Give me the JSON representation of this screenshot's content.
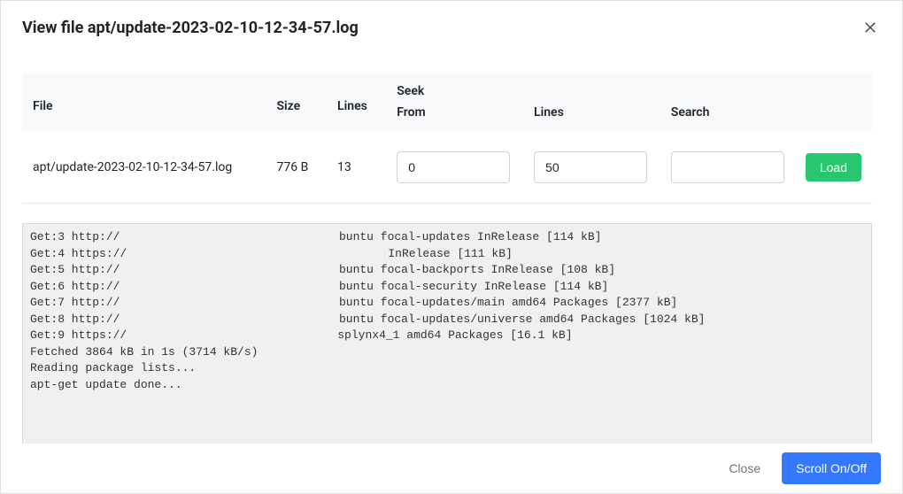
{
  "header": {
    "title": "View file apt/update-2023-02-10-12-34-57.log"
  },
  "table": {
    "columns": {
      "file": "File",
      "size": "Size",
      "lines": "Lines",
      "seek": "Seek"
    },
    "seek_columns": {
      "from": "From",
      "lines": "Lines",
      "search": "Search"
    },
    "row": {
      "file": "apt/update-2023-02-10-12-34-57.log",
      "size": "776 B",
      "lines": "13"
    },
    "inputs": {
      "from_value": "0",
      "lines_value": "50",
      "search_value": ""
    },
    "load_label": "Load"
  },
  "log_lines": [
    "Get:3 http://⠀⠀⠀⠀⠀⠀⠀⠀⠀⠀⠀⠀⠀⠀⠀⠀⠀⠀⠀⠀⠀⠀⠀⠀⠀⠀buntu focal-updates InRelease [114 kB]",
    "Get:4 https://⠀⠀⠀⠀⠀⠀⠀⠀⠀⠀⠀⠀⠀⠀⠀⠀⠀⠀⠀⠀⠀⠀⠀⠀⠀⠀⠀⠀⠀⠀⠀InRelease [111 kB]",
    "Get:5 http://⠀⠀⠀⠀⠀⠀⠀⠀⠀⠀⠀⠀⠀⠀⠀⠀⠀⠀⠀⠀⠀⠀⠀⠀⠀⠀buntu focal-backports InRelease [108 kB]",
    "Get:6 http://⠀⠀⠀⠀⠀⠀⠀⠀⠀⠀⠀⠀⠀⠀⠀⠀⠀⠀⠀⠀⠀⠀⠀⠀⠀⠀buntu focal-security InRelease [114 kB]",
    "Get:7 http://⠀⠀⠀⠀⠀⠀⠀⠀⠀⠀⠀⠀⠀⠀⠀⠀⠀⠀⠀⠀⠀⠀⠀⠀⠀⠀buntu focal-updates/main amd64 Packages [2377 kB]",
    "Get:8 http://⠀⠀⠀⠀⠀⠀⠀⠀⠀⠀⠀⠀⠀⠀⠀⠀⠀⠀⠀⠀⠀⠀⠀⠀⠀⠀buntu focal-updates/universe amd64 Packages [1024 kB]",
    "Get:9 https://⠀⠀⠀⠀⠀⠀⠀⠀⠀⠀⠀⠀⠀⠀⠀⠀⠀⠀⠀⠀⠀⠀⠀⠀⠀splynx4_1 amd64 Packages [16.1 kB]",
    "Fetched 3864 kB in 1s (3714 kB/s)",
    "Reading package lists...",
    "apt-get update done..."
  ],
  "footer": {
    "close_label": "Close",
    "scroll_label": "Scroll On/Off"
  }
}
